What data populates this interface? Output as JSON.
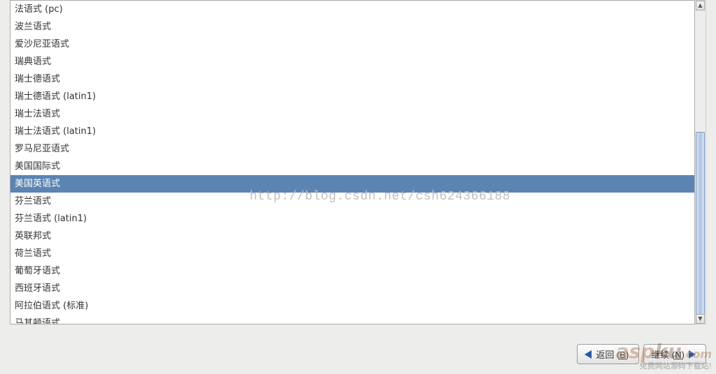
{
  "list": {
    "items": [
      "法语式 (pc)",
      "波兰语式",
      "爱沙尼亚语式",
      "瑞典语式",
      "瑞士德语式",
      "瑞士德语式 (latin1)",
      "瑞士法语式",
      "瑞士法语式 (latin1)",
      "罗马尼亚语式",
      "美国国际式",
      "美国英语式",
      "芬兰语式",
      "芬兰语式 (latin1)",
      "英联邦式",
      "荷兰语式",
      "葡萄牙语式",
      "西班牙语式",
      "阿拉伯语式 (标准)",
      "马其顿语式"
    ],
    "selected_index": 10
  },
  "watermark_url": "http://blog.csdn.net/csh624366188",
  "buttons": {
    "back": {
      "label": "返回",
      "mnemonic": "B"
    },
    "next": {
      "label": "继续",
      "mnemonic": "N"
    }
  },
  "watermark_logo": {
    "brand_a": "asp",
    "brand_b": "ku",
    "suffix": ".com",
    "tagline": "免费网站源码下载站!"
  }
}
